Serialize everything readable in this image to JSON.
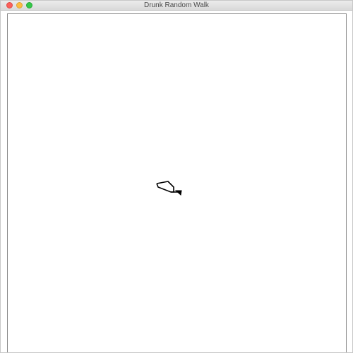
{
  "window": {
    "title": "Drunk Random Walk"
  },
  "controls": {
    "close_icon": "close-icon",
    "minimize_icon": "minimize-icon",
    "zoom_icon": "zoom-icon"
  },
  "canvas": {
    "background_color": "#ffffff",
    "stroke_color": "#000000"
  }
}
